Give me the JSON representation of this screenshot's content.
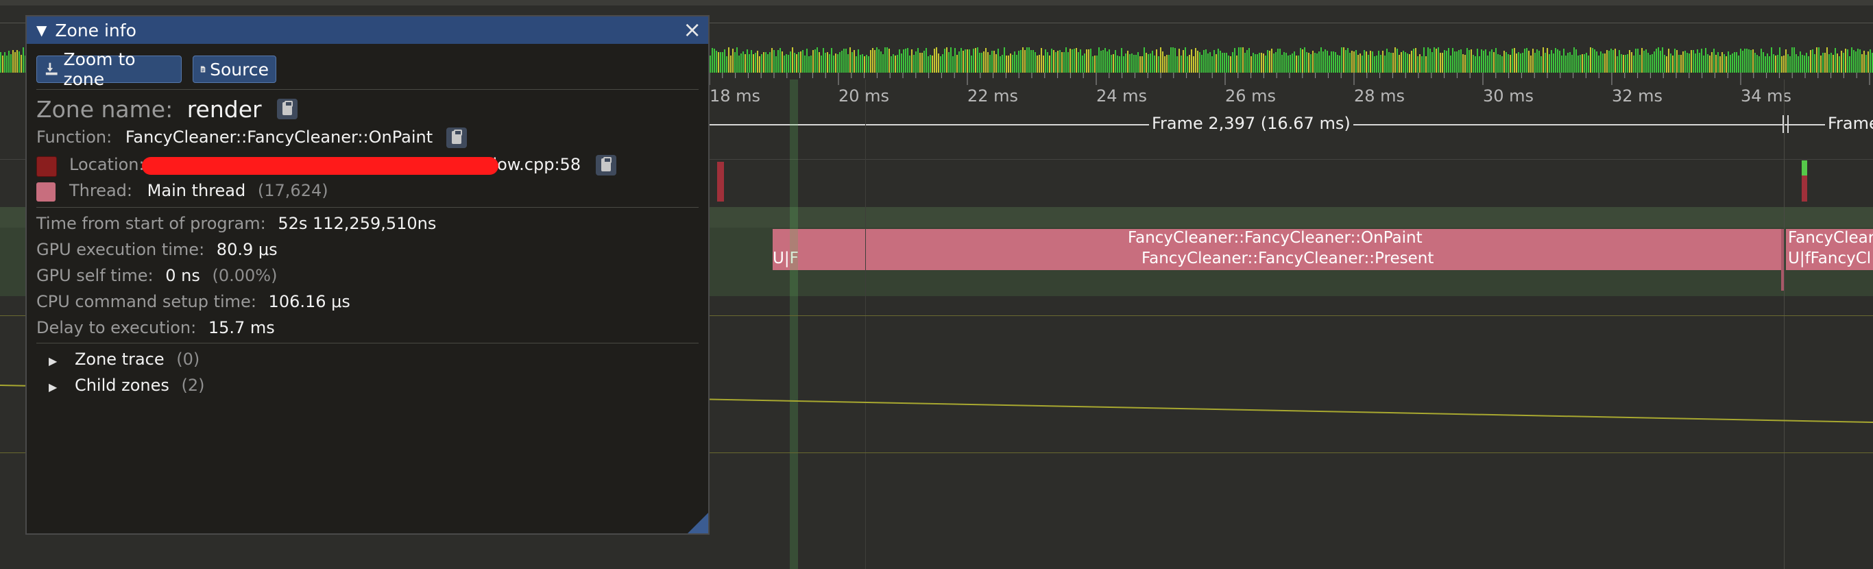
{
  "timeline": {
    "ticks": [
      "18 ms",
      "20 ms",
      "22 ms",
      "24 ms",
      "26 ms",
      "28 ms",
      "30 ms",
      "32 ms",
      "34 ms"
    ],
    "frame_label": "Frame 2,397 (16.67 ms)",
    "frame_label_next": "Frame",
    "gpu_zone_top": "FancyCleaner::FancyCleaner::OnPaint",
    "gpu_zone_bottom": "FancyCleaner::FancyCleaner::Present",
    "gpu_zone_small_left": "U|F",
    "right_zone_top": "FancyClear",
    "right_zone_bottom": "U|fFancyCl",
    "colors": {
      "background": "#2d2d2a",
      "frame_strip_green": "#3cc43c",
      "frame_strip_yellow": "#c8c832",
      "zone_pink": "#c86e7e",
      "thread_band": "#3a4636",
      "plot_line": "#a8a830"
    }
  },
  "zone_window": {
    "title": "Zone info",
    "buttons": {
      "zoom": "Zoom to zone",
      "source": "Source"
    },
    "zone_name_label": "Zone name:",
    "zone_name_value": "render",
    "function_label": "Function:",
    "function_value": "FancyCleaner::FancyCleaner::OnPaint",
    "location_label": "Location:",
    "location_value_tail": "\\window.cpp:58",
    "location_color": "#8a1e1e",
    "thread_label": "Thread:",
    "thread_value": "Main thread",
    "thread_id": "(17,624)",
    "thread_color": "#c86e7e",
    "stats": [
      {
        "label": "Time from start of program:",
        "value": "52s 112,259,510ns",
        "extra": ""
      },
      {
        "label": "GPU execution time:",
        "value": "80.9 μs",
        "extra": ""
      },
      {
        "label": "GPU self time:",
        "value": "0 ns",
        "extra": "(0.00%)"
      },
      {
        "label": "CPU command setup time:",
        "value": "106.16 μs",
        "extra": ""
      },
      {
        "label": "Delay to execution:",
        "value": "15.7 ms",
        "extra": ""
      }
    ],
    "tree": [
      {
        "label": "Zone trace",
        "count": "(0)"
      },
      {
        "label": "Child zones",
        "count": "(2)"
      }
    ],
    "icons": {
      "collapse": "collapse-triangle-icon",
      "close": "close-icon",
      "zoom": "zoom-to-zone-icon",
      "source": "document-icon",
      "copy": "clipboard-icon",
      "expand": "expand-arrow-icon"
    }
  }
}
